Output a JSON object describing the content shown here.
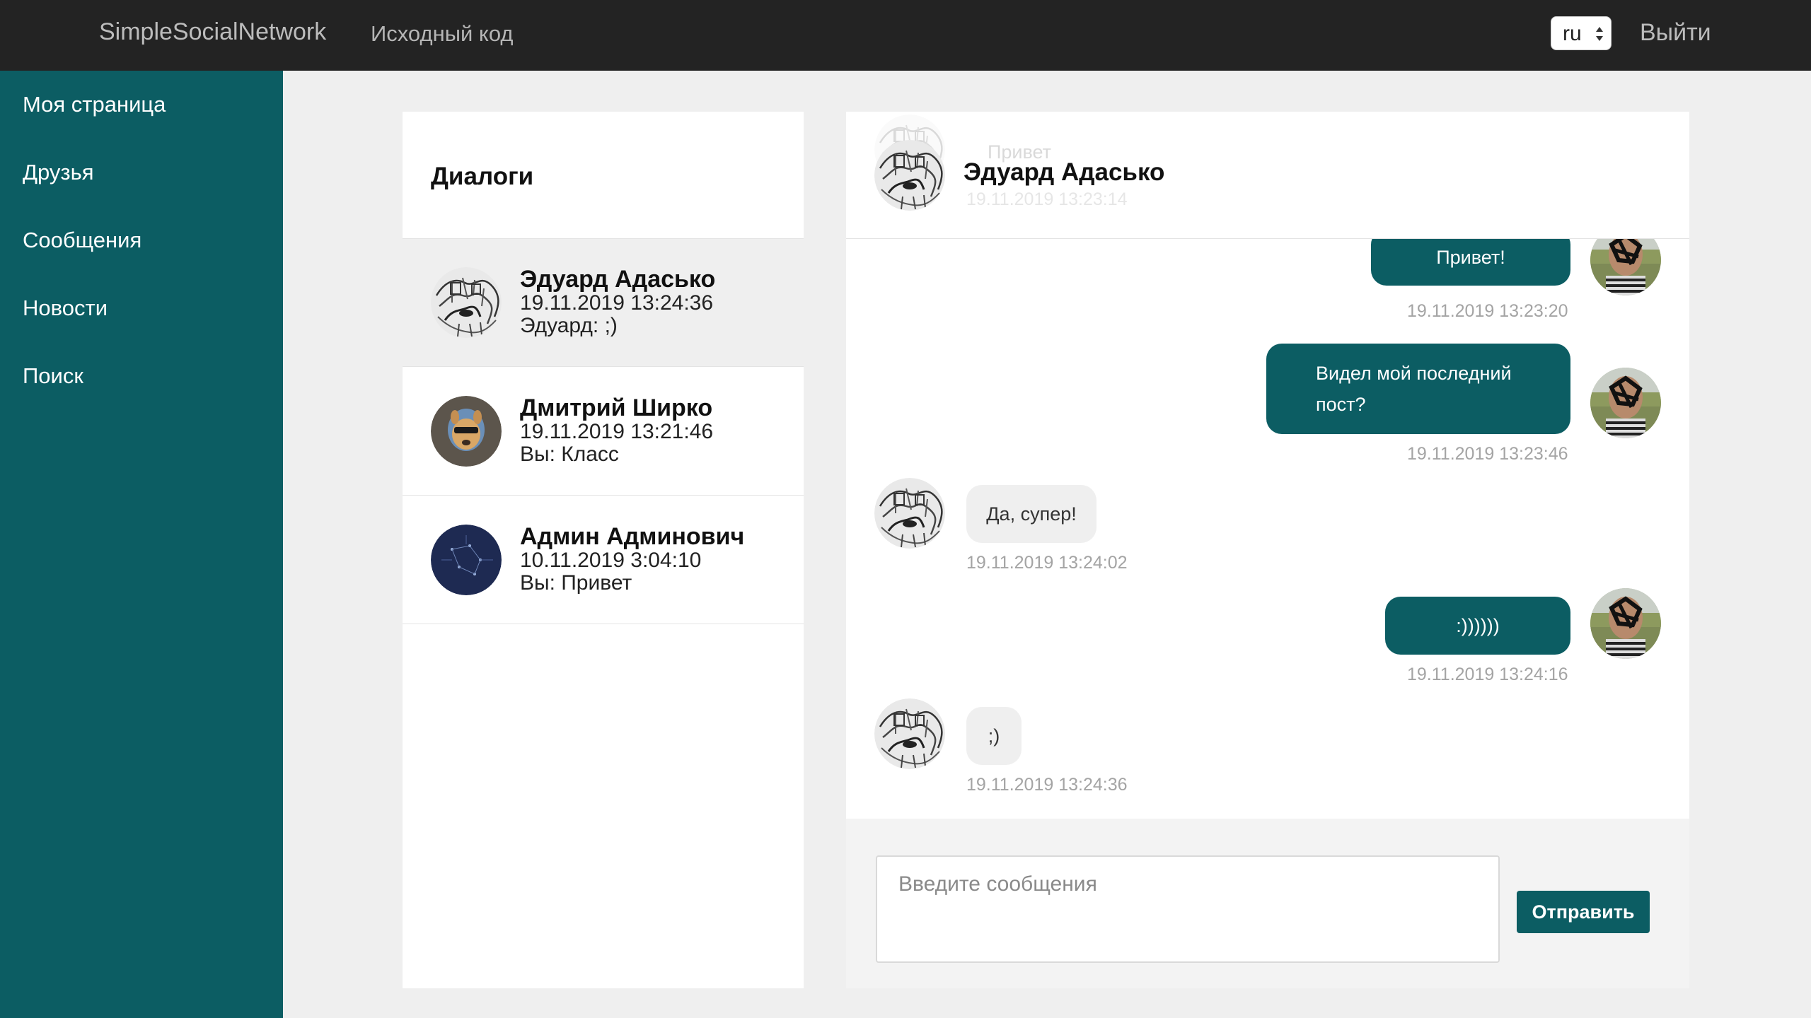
{
  "navbar": {
    "brand": "SimpleSocialNetwork",
    "source_link": "Исходный код",
    "lang_value": "ru",
    "logout": "Выйти"
  },
  "sidebar": {
    "items": [
      {
        "label": "Моя страница"
      },
      {
        "label": "Друзья"
      },
      {
        "label": "Сообщения"
      },
      {
        "label": "Новости"
      },
      {
        "label": "Поиск"
      }
    ]
  },
  "dialogs": {
    "title": "Диалоги",
    "items": [
      {
        "name": "Эдуард Адасько",
        "date": "19.11.2019 13:24:36",
        "last": "Эдуард: ;)",
        "active": true
      },
      {
        "name": "Дмитрий Ширко",
        "date": "19.11.2019 13:21:46",
        "last": "Вы: Класс",
        "active": false
      },
      {
        "name": "Админ Админович",
        "date": "10.11.2019 3:04:10",
        "last": "Вы: Привет",
        "active": false
      }
    ]
  },
  "chat": {
    "header_name": "Эдуард Адасько",
    "ghost_text": "Привет",
    "ghost_time": "19.11.2019 13:23:14",
    "messages": [
      {
        "direction": "out",
        "text": "Привет!",
        "time": "19.11.2019 13:23:20"
      },
      {
        "direction": "out",
        "text": "Видел мой последний пост?",
        "time": "19.11.2019 13:23:46"
      },
      {
        "direction": "in",
        "text": "Да, супер!",
        "time": "19.11.2019 13:24:02"
      },
      {
        "direction": "out",
        "text": ":))))))",
        "time": "19.11.2019 13:24:16"
      },
      {
        "direction": "in",
        "text": ";)",
        "time": "19.11.2019 13:24:36"
      }
    ],
    "input_placeholder": "Введите сообщения",
    "send_label": "Отправить"
  },
  "colors": {
    "accent": "#0c5d63",
    "navbar": "#232323",
    "page_bg": "#efefef"
  }
}
